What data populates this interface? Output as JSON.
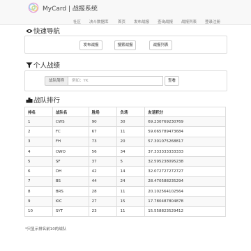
{
  "header": {
    "brand": "MyCard | 战报系统",
    "nav": [
      "社区",
      "决斗数据库",
      "首页",
      "发布战报",
      "查询战报",
      "战报列表",
      "登录注册"
    ]
  },
  "quick_nav": {
    "title": "快速导航",
    "buttons": [
      "发布战报",
      "搜索战报",
      "战报列表"
    ]
  },
  "personal": {
    "title": "个人战绩",
    "addon_label": "战队简称",
    "search_placeholder": "例如：YK",
    "query_label": "查看"
  },
  "ranking": {
    "title": "战队排行",
    "columns": [
      "排名",
      "战队名",
      "胜场",
      "负场",
      "友谊积分"
    ],
    "rows": [
      [
        "1",
        "CWS",
        "90",
        "30",
        "69.230769230769"
      ],
      [
        "2",
        "FC",
        "67",
        "11",
        "59.065789473684"
      ],
      [
        "3",
        "FH",
        "73",
        "20",
        "57.301075268817"
      ],
      [
        "4",
        "OWO",
        "56",
        "34",
        "37.333333333333"
      ],
      [
        "5",
        "SF",
        "37",
        "5",
        "32.595238095238"
      ],
      [
        "6",
        "DH",
        "42",
        "14",
        "32.072727272727"
      ],
      [
        "7",
        "BS",
        "44",
        "24",
        "28.470588235294"
      ],
      [
        "8",
        "BRS",
        "28",
        "11",
        "20.102564102564"
      ],
      [
        "9",
        "KIC",
        "27",
        "15",
        "17.780487804878"
      ],
      [
        "10",
        "SYT",
        "23",
        "11",
        "15.558823529412"
      ]
    ],
    "note": "*只显示排名前10的战队"
  }
}
